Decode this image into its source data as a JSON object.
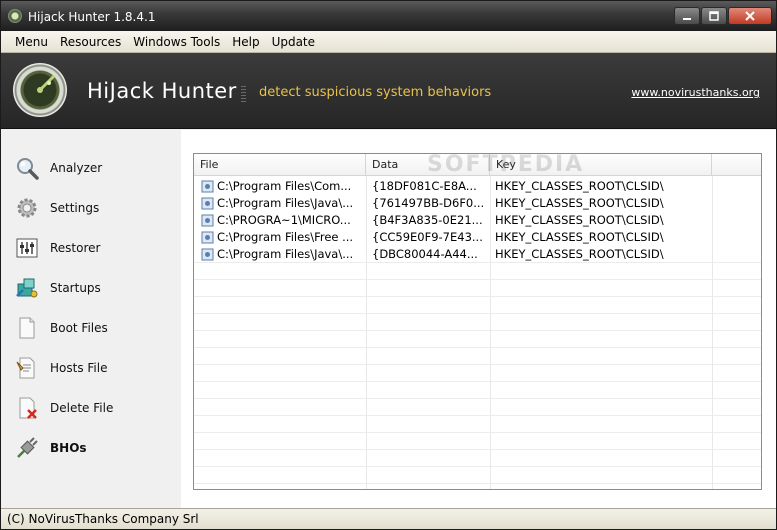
{
  "window": {
    "title": "Hijack Hunter 1.8.4.1",
    "icon": "hijack-hunter-app-icon"
  },
  "menubar": {
    "items": [
      {
        "label": "Menu"
      },
      {
        "label": "Resources"
      },
      {
        "label": "Windows Tools"
      },
      {
        "label": "Help"
      },
      {
        "label": "Update"
      }
    ]
  },
  "banner": {
    "title_bold": "HiJack",
    "title_rest": "Hunter",
    "tagline": "detect suspicious system behaviors",
    "link": "www.novirusthanks.org",
    "colors": {
      "tagline": "#e8c24a",
      "background": "#2f2f2f"
    }
  },
  "sidebar": {
    "items": [
      {
        "label": "Analyzer",
        "icon": "magnifier-icon"
      },
      {
        "label": "Settings",
        "icon": "gear-icon"
      },
      {
        "label": "Restorer",
        "icon": "sliders-icon"
      },
      {
        "label": "Startups",
        "icon": "startup-puzzle-icon"
      },
      {
        "label": "Boot Files",
        "icon": "document-icon"
      },
      {
        "label": "Hosts File",
        "icon": "hosts-file-icon"
      },
      {
        "label": "Delete File",
        "icon": "delete-file-icon"
      },
      {
        "label": "BHOs",
        "icon": "plug-icon",
        "active": true
      }
    ]
  },
  "list": {
    "columns": [
      "File",
      "Data",
      "Key"
    ],
    "rows": [
      {
        "file": "C:\\Program Files\\Com...",
        "data": "{18DF081C-E8A...",
        "key": "HKEY_CLASSES_ROOT\\CLSID\\"
      },
      {
        "file": "C:\\Program Files\\Java\\...",
        "data": "{761497BB-D6F0...",
        "key": "HKEY_CLASSES_ROOT\\CLSID\\"
      },
      {
        "file": "C:\\PROGRA~1\\MICRO...",
        "data": "{B4F3A835-0E21...",
        "key": "HKEY_CLASSES_ROOT\\CLSID\\"
      },
      {
        "file": "C:\\Program Files\\Free ...",
        "data": "{CC59E0F9-7E43...",
        "key": "HKEY_CLASSES_ROOT\\CLSID\\"
      },
      {
        "file": "C:\\Program Files\\Java\\...",
        "data": "{DBC80044-A44...",
        "key": "HKEY_CLASSES_ROOT\\CLSID\\"
      }
    ]
  },
  "watermark": "SOFTPEDIA",
  "statusbar": {
    "text": "(C) NoVirusThanks Company Srl"
  }
}
